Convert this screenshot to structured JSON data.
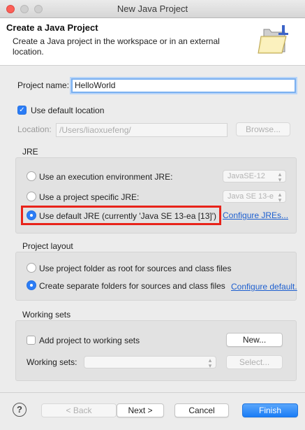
{
  "window": {
    "title": "New Java Project"
  },
  "header": {
    "title": "Create a Java Project",
    "description": "Create a Java project in the workspace or in an external location."
  },
  "project": {
    "name_label": "Project name:",
    "name_value": "HelloWorld",
    "default_location_label": "Use default location",
    "default_location_checked": true,
    "location_label": "Location:",
    "location_value": "/Users/liaoxuefeng/",
    "browse_label": "Browse..."
  },
  "jre": {
    "title": "JRE",
    "options": [
      {
        "label": "Use an execution environment JRE:",
        "selected": false,
        "combo": "JavaSE-12"
      },
      {
        "label": "Use a project specific JRE:",
        "selected": false,
        "combo": "Java SE 13-e"
      },
      {
        "label": "Use default JRE (currently 'Java SE 13-ea [13]')",
        "selected": true
      }
    ],
    "configure_link": "Configure JREs..."
  },
  "layout": {
    "title": "Project layout",
    "options": [
      {
        "label": "Use project folder as root for sources and class files",
        "selected": false
      },
      {
        "label": "Create separate folders for sources and class files",
        "selected": true
      }
    ],
    "configure_link": "Configure default."
  },
  "working_sets": {
    "title": "Working sets",
    "add_label": "Add project to working sets",
    "add_checked": false,
    "new_label": "New...",
    "sets_label": "Working sets:",
    "select_label": "Select..."
  },
  "footer": {
    "help": "?",
    "back_label": "< Back",
    "next_label": "Next >",
    "cancel_label": "Cancel",
    "finish_label": "Finish"
  },
  "colors": {
    "accent": "#2b7cf6",
    "highlight": "#e8231a",
    "link": "#1d5fcf"
  }
}
